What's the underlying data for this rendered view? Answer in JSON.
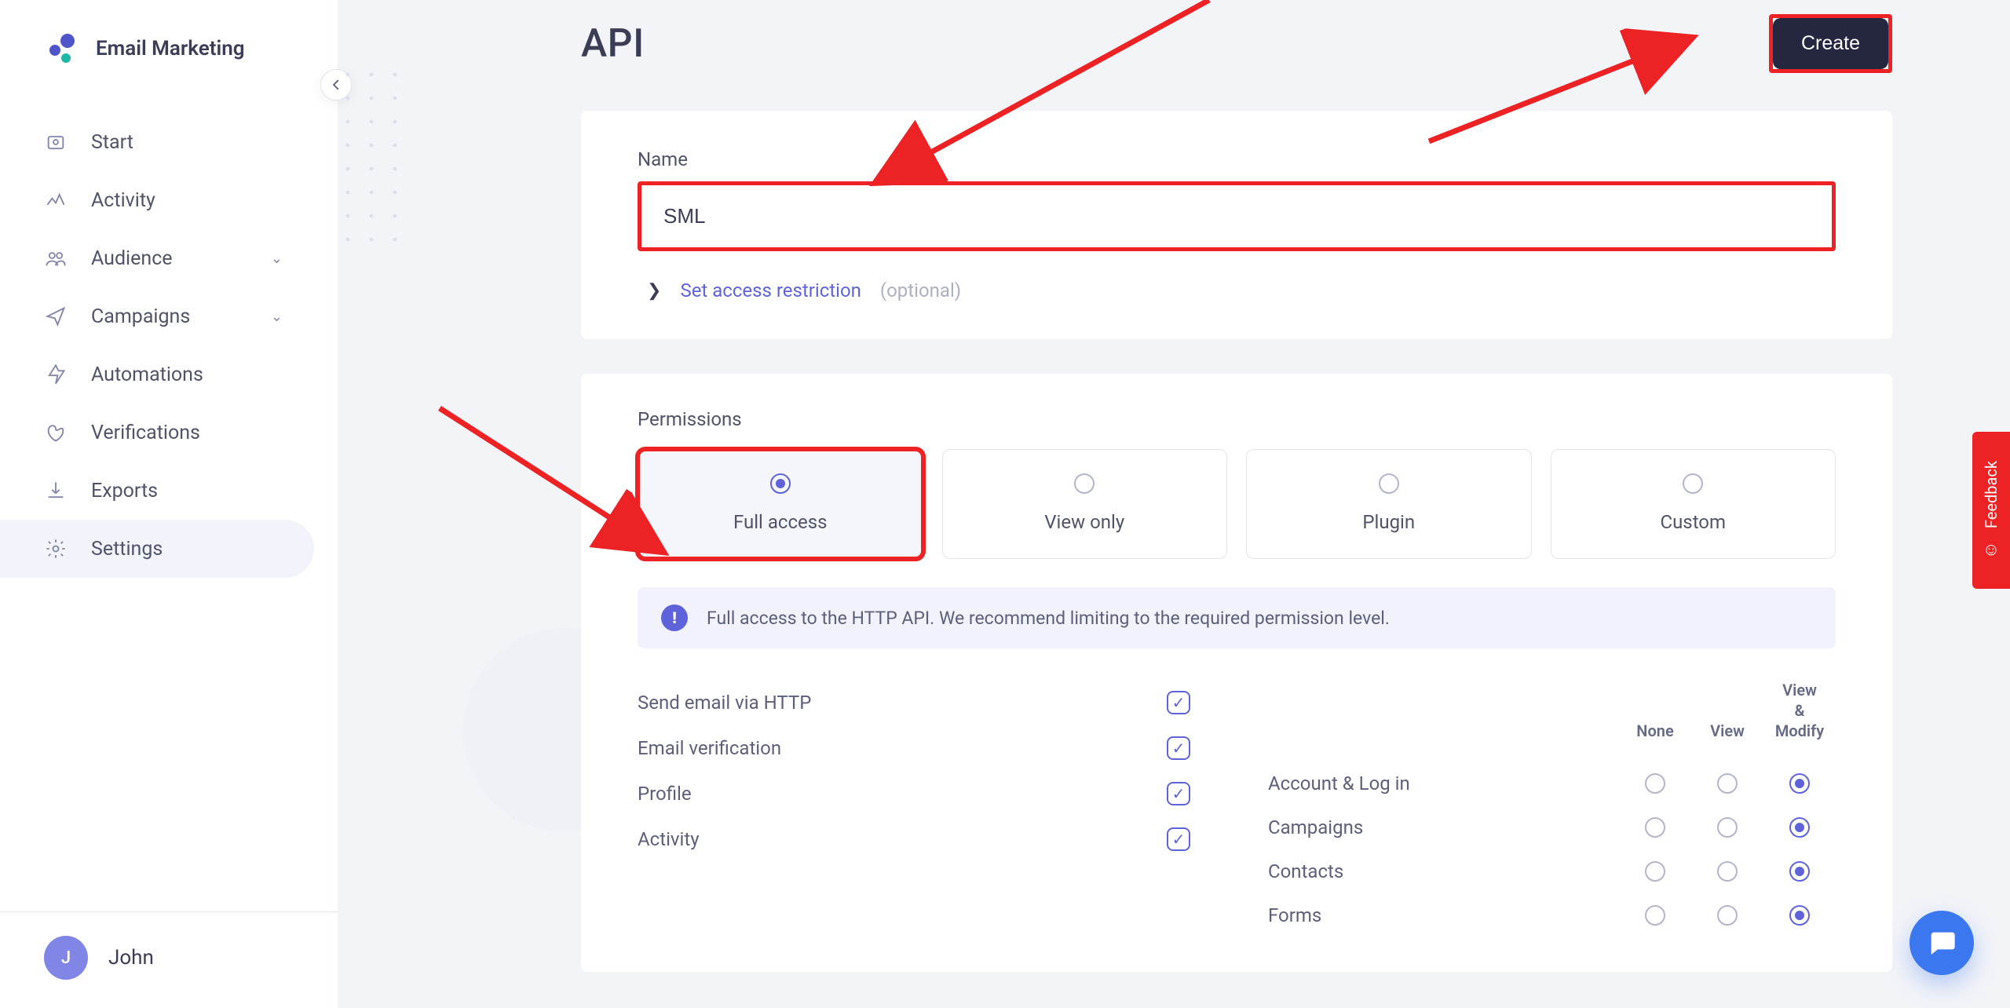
{
  "brand": {
    "name": "Email Marketing"
  },
  "sidebar": {
    "items": [
      {
        "label": "Start",
        "icon": "home-icon",
        "expandable": false
      },
      {
        "label": "Activity",
        "icon": "activity-icon",
        "expandable": false
      },
      {
        "label": "Audience",
        "icon": "audience-icon",
        "expandable": true
      },
      {
        "label": "Campaigns",
        "icon": "campaigns-icon",
        "expandable": true
      },
      {
        "label": "Automations",
        "icon": "automations-icon",
        "expandable": false
      },
      {
        "label": "Verifications",
        "icon": "verifications-icon",
        "expandable": false
      },
      {
        "label": "Exports",
        "icon": "exports-icon",
        "expandable": false
      },
      {
        "label": "Settings",
        "icon": "settings-icon",
        "expandable": false,
        "active": true
      }
    ]
  },
  "user": {
    "initial": "J",
    "name": "John"
  },
  "page": {
    "title": "API",
    "create_label": "Create",
    "name_label": "Name",
    "name_value": "SML",
    "access_link": "Set access restriction",
    "access_optional": "(optional)"
  },
  "permissions": {
    "section_label": "Permissions",
    "options": [
      {
        "label": "Full access",
        "selected": true
      },
      {
        "label": "View only",
        "selected": false
      },
      {
        "label": "Plugin",
        "selected": false
      },
      {
        "label": "Custom",
        "selected": false
      }
    ],
    "info": "Full access to the HTTP API. We recommend limiting to the required permission level.",
    "left_rows": [
      {
        "label": "Send email via HTTP",
        "checked": true
      },
      {
        "label": "Email verification",
        "checked": true
      },
      {
        "label": "Profile",
        "checked": true
      },
      {
        "label": "Activity",
        "checked": true
      }
    ],
    "right_headers": {
      "none": "None",
      "view": "View",
      "vm": "View\n&\nModify"
    },
    "right_rows": [
      {
        "label": "Account & Log in",
        "value": "vm"
      },
      {
        "label": "Campaigns",
        "value": "vm"
      },
      {
        "label": "Contacts",
        "value": "vm"
      },
      {
        "label": "Forms",
        "value": "vm"
      }
    ]
  },
  "feedback_label": "Feedback"
}
